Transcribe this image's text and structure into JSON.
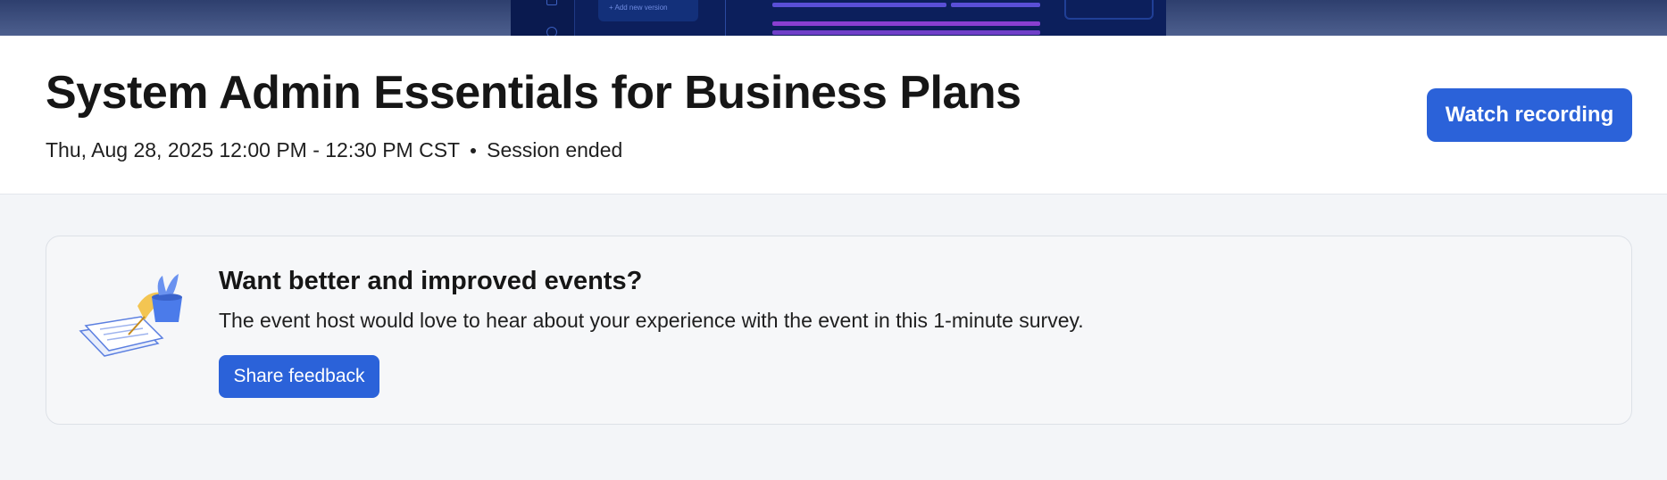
{
  "hero": {
    "add_version_label": "+ Add new version"
  },
  "session": {
    "title": "System Admin Essentials for Business Plans",
    "datetime": "Thu, Aug 28, 2025 12:00 PM - 12:30 PM CST",
    "status": "Session ended",
    "watch_label": "Watch recording"
  },
  "feedback": {
    "title": "Want better and improved events?",
    "text": "The event host would love to hear about your experience with the event in this 1-minute survey.",
    "button_label": "Share feedback"
  },
  "colors": {
    "accent": "#2b62d9",
    "header_bg": "#ffffff",
    "page_bg": "#f3f5f8"
  }
}
